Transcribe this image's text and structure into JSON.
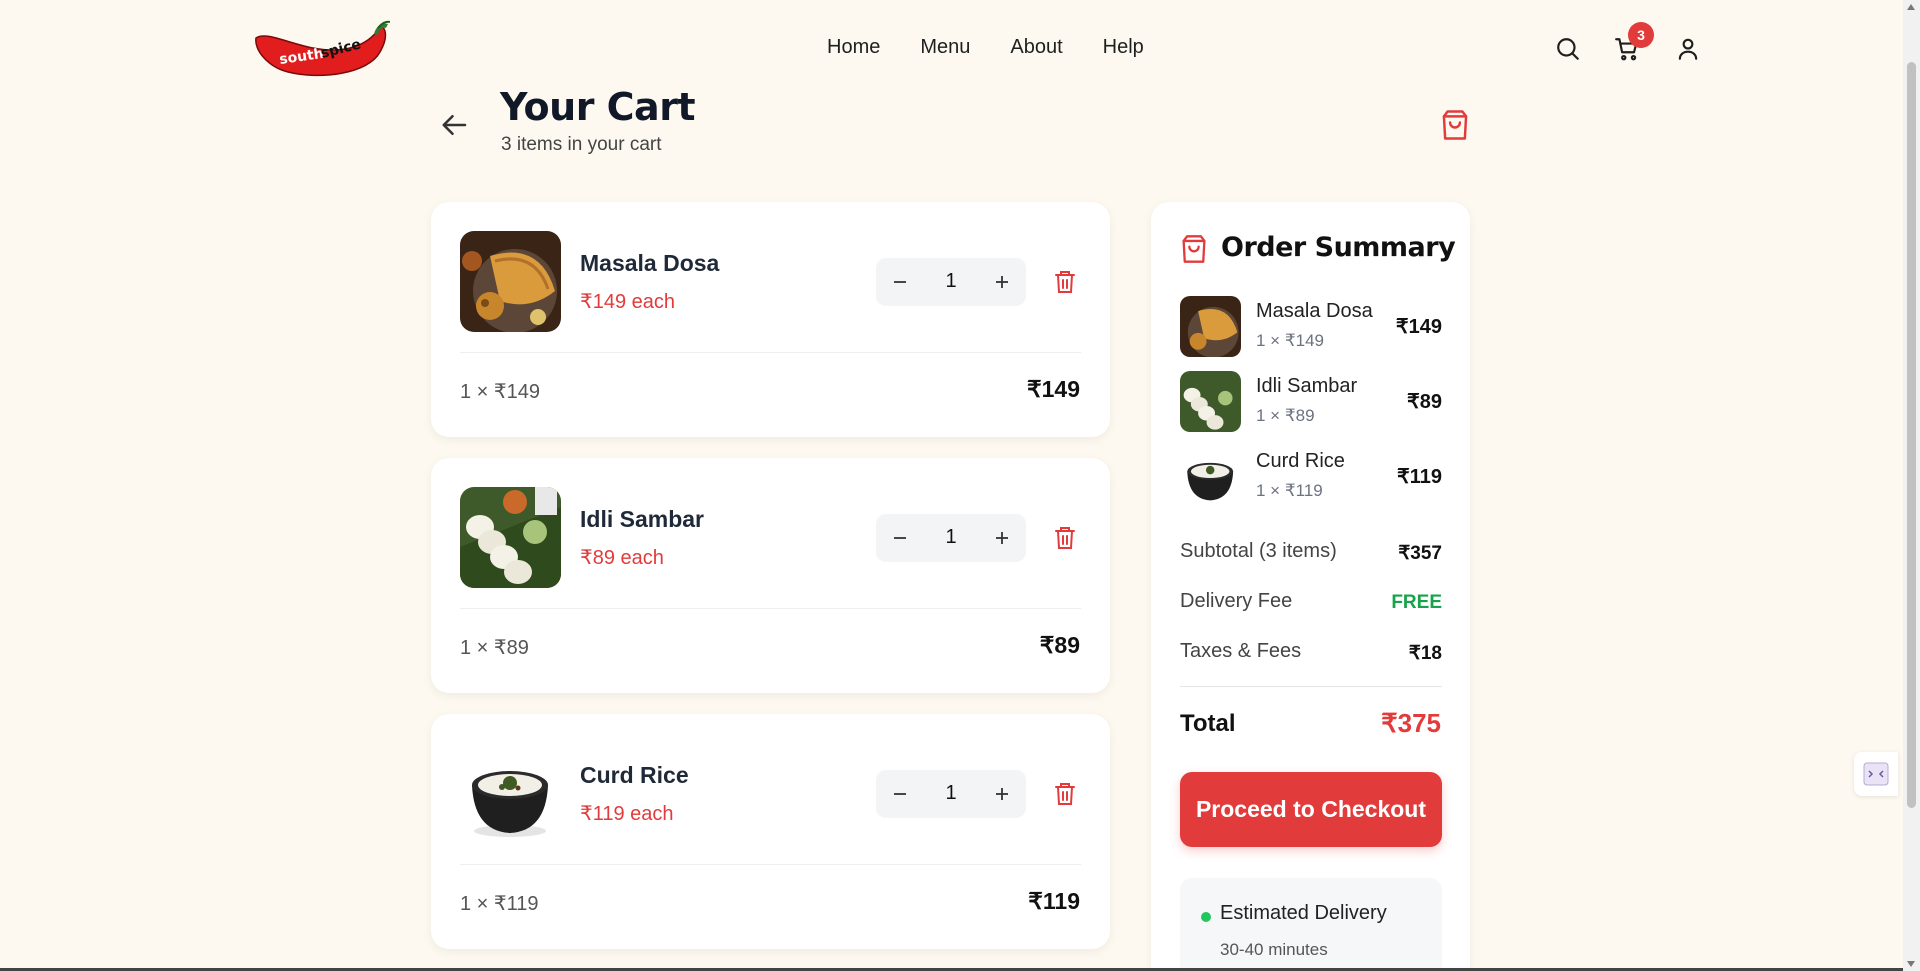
{
  "brand": {
    "logo_text_1": "south",
    "logo_text_2": "spice"
  },
  "nav": {
    "home": "Home",
    "menu": "Menu",
    "about": "About",
    "help": "Help"
  },
  "header": {
    "cart_count": "3"
  },
  "page": {
    "title": "Your Cart",
    "subtitle": "3 items in your cart"
  },
  "items": [
    {
      "name": "Masala Dosa",
      "price": "₹149 each",
      "qty": "1",
      "calc": "1 × ₹149",
      "total": "₹149"
    },
    {
      "name": "Idli Sambar",
      "price": "₹89 each",
      "qty": "1",
      "calc": "1 × ₹89",
      "total": "₹89"
    },
    {
      "name": "Curd Rice",
      "price": "₹119 each",
      "qty": "1",
      "calc": "1 × ₹119",
      "total": "₹119"
    }
  ],
  "summary": {
    "title": "Order Summary",
    "items": [
      {
        "name": "Masala Dosa",
        "sub": "1 × ₹149",
        "price": "₹149"
      },
      {
        "name": "Idli Sambar",
        "sub": "1 × ₹89",
        "price": "₹89"
      },
      {
        "name": "Curd Rice",
        "sub": "1 × ₹119",
        "price": "₹119"
      }
    ],
    "subtotal_label": "Subtotal (3 items)",
    "subtotal": "₹357",
    "delivery_label": "Delivery Fee",
    "delivery": "FREE",
    "taxes_label": "Taxes & Fees",
    "taxes": "₹18",
    "total_label": "Total",
    "total": "₹375",
    "checkout": "Proceed to Checkout",
    "est_title": "Estimated Delivery",
    "est_time": "30-40 minutes"
  },
  "colors": {
    "accent": "#e23b3b",
    "background": "#fdf9f0",
    "free": "#16a34a"
  }
}
